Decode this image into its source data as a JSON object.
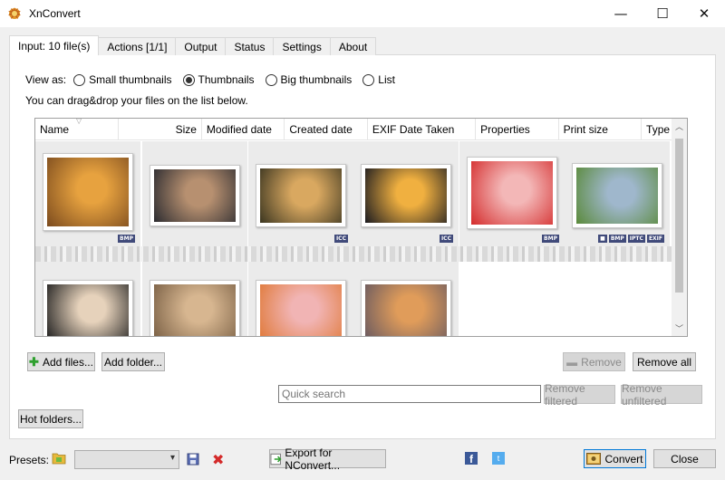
{
  "window": {
    "title": "XnConvert",
    "minimize": "—",
    "maximize": "☐",
    "close": "✕"
  },
  "tabs": [
    {
      "label": "Input: 10 file(s)",
      "active": true
    },
    {
      "label": "Actions [1/1]"
    },
    {
      "label": "Output"
    },
    {
      "label": "Status"
    },
    {
      "label": "Settings"
    },
    {
      "label": "About"
    }
  ],
  "view_as": {
    "label": "View as:",
    "options": [
      {
        "label": "Small thumbnails",
        "selected": false
      },
      {
        "label": "Thumbnails",
        "selected": true
      },
      {
        "label": "Big thumbnails",
        "selected": false
      },
      {
        "label": "List",
        "selected": false
      }
    ]
  },
  "hint": "You can drag&drop your files on the list below.",
  "columns": [
    "Name",
    "Size",
    "Modified date",
    "Created date",
    "EXIF Date Taken",
    "Properties",
    "Print size",
    "Type"
  ],
  "thumbnails": [
    {
      "subject": "whale-sunset",
      "colors": [
        "#e7a23f",
        "#7a4a1e"
      ],
      "badges": [
        "BMP"
      ]
    },
    {
      "subject": "ruined-building",
      "colors": [
        "#b79070",
        "#2b2b30"
      ],
      "badges": []
    },
    {
      "subject": "glass-sphere",
      "colors": [
        "#d9a860",
        "#3a3520"
      ],
      "badges": [
        "ICC"
      ]
    },
    {
      "subject": "bokeh-lights",
      "colors": [
        "#f0b040",
        "#1a1a20"
      ],
      "badges": [
        "ICC"
      ]
    },
    {
      "subject": "ladybug",
      "colors": [
        "#f3b7b7",
        "#d42b2b"
      ],
      "badges": [
        "BMP"
      ]
    },
    {
      "subject": "group-selfie",
      "colors": [
        "#9fb7cc",
        "#5a8a3a"
      ],
      "badges": [
        "■",
        "BMP",
        "IPTC",
        "EXIF"
      ]
    },
    {
      "subject": "girl-camera",
      "colors": [
        "#e6d2bb",
        "#1f1f1f"
      ],
      "badges": []
    },
    {
      "subject": "two-girls-laughing",
      "colors": [
        "#d7b690",
        "#7a6045"
      ],
      "badges": []
    },
    {
      "subject": "child-cake",
      "colors": [
        "#f1b4b4",
        "#e07a3a"
      ],
      "badges": []
    },
    {
      "subject": "autumn-tree",
      "colors": [
        "#e09c5a",
        "#6a5a60"
      ],
      "badges": []
    }
  ],
  "buttons": {
    "add_files": "Add files...",
    "add_folder": "Add folder...",
    "remove": "Remove",
    "remove_all": "Remove all",
    "remove_filtered": "Remove filtered",
    "remove_unfiltered": "Remove unfiltered",
    "hot_folders": "Hot folders...",
    "export_nconvert": "Export for NConvert...",
    "convert": "Convert",
    "close": "Close"
  },
  "search": {
    "placeholder": "Quick search",
    "value": ""
  },
  "presets": {
    "label": "Presets:",
    "selected": ""
  },
  "social": {
    "facebook": "f",
    "twitter": "t"
  },
  "colors": {
    "accent_blue": "#0078d7",
    "badge": "#404a7a"
  }
}
